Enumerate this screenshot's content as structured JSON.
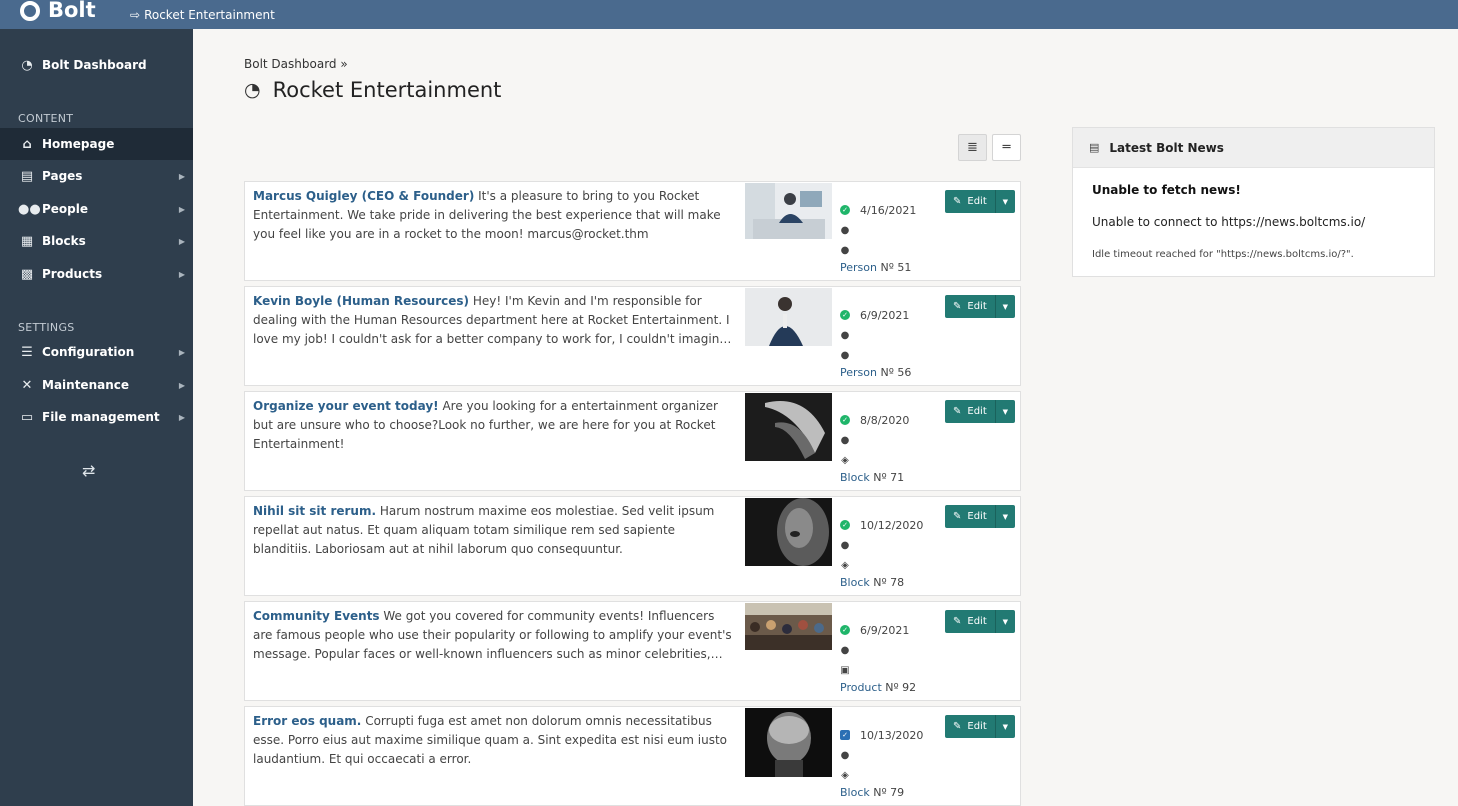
{
  "header": {
    "logo_text": "Bolt",
    "site_link": "Rocket Entertainment"
  },
  "sidebar": {
    "dashboard": "Bolt Dashboard",
    "content_label": "CONTENT",
    "settings_label": "SETTINGS",
    "items": [
      {
        "label": "Homepage",
        "icon": "home-icon"
      },
      {
        "label": "Pages",
        "icon": "file-icon"
      },
      {
        "label": "People",
        "icon": "users-icon"
      },
      {
        "label": "Blocks",
        "icon": "cubes-icon"
      },
      {
        "label": "Products",
        "icon": "gifts-icon"
      },
      {
        "label": "Configuration",
        "icon": "sliders-icon"
      },
      {
        "label": "Maintenance",
        "icon": "tools-icon"
      },
      {
        "label": "File management",
        "icon": "folder-open-icon"
      }
    ]
  },
  "main": {
    "breadcrumb": "Bolt Dashboard »",
    "title": "Rocket Entertainment"
  },
  "records": [
    {
      "title": "Marcus Quigley (CEO & Founder)",
      "excerpt": " It's a pleasure to bring to you Rocket Entertainment. We take pride in delivering the best experience that will make you feel like you are in a rocket to the moon! marcus@rocket.thm",
      "date": "4/16/2021",
      "status": "published",
      "type": "Person",
      "number": "Nº 51",
      "type_icon": "user-icon",
      "edit": "Edit"
    },
    {
      "title": "Kevin Boyle (Human Resources)",
      "excerpt": " Hey! I'm Kevin and I'm responsible for dealing with the Human Resources department here at Rocket Entertainment. I love my job! I couldn't ask for a better company to work for, I couldn't imagine working for anyo…",
      "date": "6/9/2021",
      "status": "published",
      "type": "Person",
      "number": "Nº 56",
      "type_icon": "user-icon",
      "edit": "Edit"
    },
    {
      "title": "Organize your event today!",
      "excerpt": " Are you looking for a entertainment organizer but are unsure who to choose?Look no further, we are here for you at Rocket Entertainment!",
      "date": "8/8/2020",
      "status": "published",
      "type": "Block",
      "number": "Nº 71",
      "type_icon": "cube-icon",
      "edit": "Edit"
    },
    {
      "title": "Nihil sit sit rerum.",
      "excerpt": " Harum nostrum maxime eos molestiae. Sed velit ipsum repellat aut natus. Et quam aliquam totam similique rem sed sapiente blanditiis. Laboriosam aut at nihil laborum quo consequuntur.",
      "date": "10/12/2020",
      "status": "published",
      "type": "Block",
      "number": "Nº 78",
      "type_icon": "cube-icon",
      "edit": "Edit"
    },
    {
      "title": "Community Events",
      "excerpt": " We got you covered for community events! Influencers are famous people who use their popularity or following to amplify your event's message. Popular faces or well-known influencers such as minor celebrities,…",
      "date": "6/9/2021",
      "status": "published",
      "type": "Product",
      "number": "Nº 92",
      "type_icon": "gift-icon",
      "edit": "Edit"
    },
    {
      "title": "Error eos quam.",
      "excerpt": " Corrupti fuga est amet non dolorum omnis necessitatibus esse. Porro eius aut maxime similique quam a. Sint expedita est nisi eum iusto laudantium. Et qui occaecati a error.",
      "date": "10/13/2020",
      "status": "held",
      "type": "Block",
      "number": "Nº 79",
      "type_icon": "cube-icon",
      "edit": "Edit"
    }
  ],
  "news": {
    "title": "Latest Bolt News",
    "error_title": "Unable to fetch news!",
    "message": "Unable to connect to https://news.boltcms.io/",
    "detail": "Idle timeout reached for \"https://news.boltcms.io/?\"."
  },
  "colors": {
    "topbar": "#4a6a8e",
    "sidebar": "#2f3e4d",
    "accent": "#227a73",
    "link": "#2c5f8a"
  }
}
